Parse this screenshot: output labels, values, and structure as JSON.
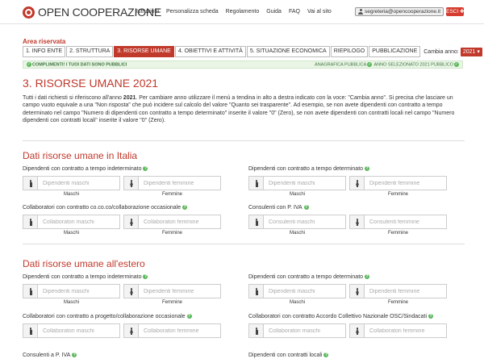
{
  "header": {
    "logo_text": "OPEN COOPERAZIONE",
    "nav": [
      "Istruzioni",
      "Personalizza scheda",
      "Regolamento",
      "Guida",
      "FAQ",
      "Vai al sito"
    ],
    "user_email": "segreteria@opencooperazione.it",
    "exit_label": "ESCI"
  },
  "area": {
    "title": "Area riservata",
    "steps": [
      "1. INFO ENTE",
      "2. STRUTTURA",
      "3. RISORSE UMANE",
      "4. OBIETTIVI E ATTIVITÀ",
      "5. SITUAZIONE ECONOMICA",
      "RIEPILOGO",
      "PUBBLICAZIONE"
    ],
    "active_step": 2,
    "year_label": "Cambia anno:",
    "year_value": "2021 ▾"
  },
  "status": {
    "left": "COMPLIMENTI! I TUOI DATI SONO PUBBLICI",
    "right_1": "ANAGRAFICA PUBBLICA",
    "right_2": "ANNO SELEZIONATO 2021 PUBBLICO"
  },
  "page": {
    "title": "3. RISORSE UMANE 2021",
    "intro_1": "Tutti i dati richiesti si riferiscono all'anno ",
    "intro_year": "2021",
    "intro_2": ". Per cambiare anno utilizzare il menù a tendina in alto a destra indicato con la voce: \"Cambia anno\". Si precisa che lasciare un campo vuoto equivale a una \"Non risposta\" che può incidere sul calcolo del valore \"Quanto sei trasparente\". Ad esempio, se non avete dipendenti con contratto a tempo determinato nel campo \"Numero di dipendenti con contratto a tempo determinato\" inserite il valore \"0\" (Zero), se non avete dipendenti con contratti locali nel campo \"Numero dipendenti con contratti locali\" inserite il valore \"0\" (Zero)."
  },
  "common": {
    "ph_male": "Dipendenti maschi",
    "ph_female": "Dipendenti femmine",
    "ph_collab_male": "Collaboratori maschi",
    "ph_collab_female": "Collaboratori femmine",
    "ph_cons_male": "Consulenti maschi",
    "ph_cons_female": "Consulenti femmine",
    "sub_male": "Maschi",
    "sub_female": "Femmine"
  },
  "italia": {
    "title": "Dati risorse umane in Italia",
    "f1": "Dipendenti con contratto a tempo indeterminato",
    "f2": "Dipendenti con contratto a tempo determinato",
    "f3": "Collaboratori con contratto co.co.co/collaborazione occasionale",
    "f4": "Consulenti con P. IVA"
  },
  "estero": {
    "title": "Dati risorse umane all'estero",
    "f1": "Dipendenti con contratto a tempo indeterminato",
    "f2": "Dipendenti con contratto a tempo determinato",
    "f3": "Collaboratori con contratto a progetto/collaborazione occasionale",
    "f4": "Collaboratori con contratto Accordo Collettivo Nazionale OSC/Sindacati",
    "f5": "Consulenti a P. IVA",
    "f6": "Dipendenti con contratti locali"
  }
}
